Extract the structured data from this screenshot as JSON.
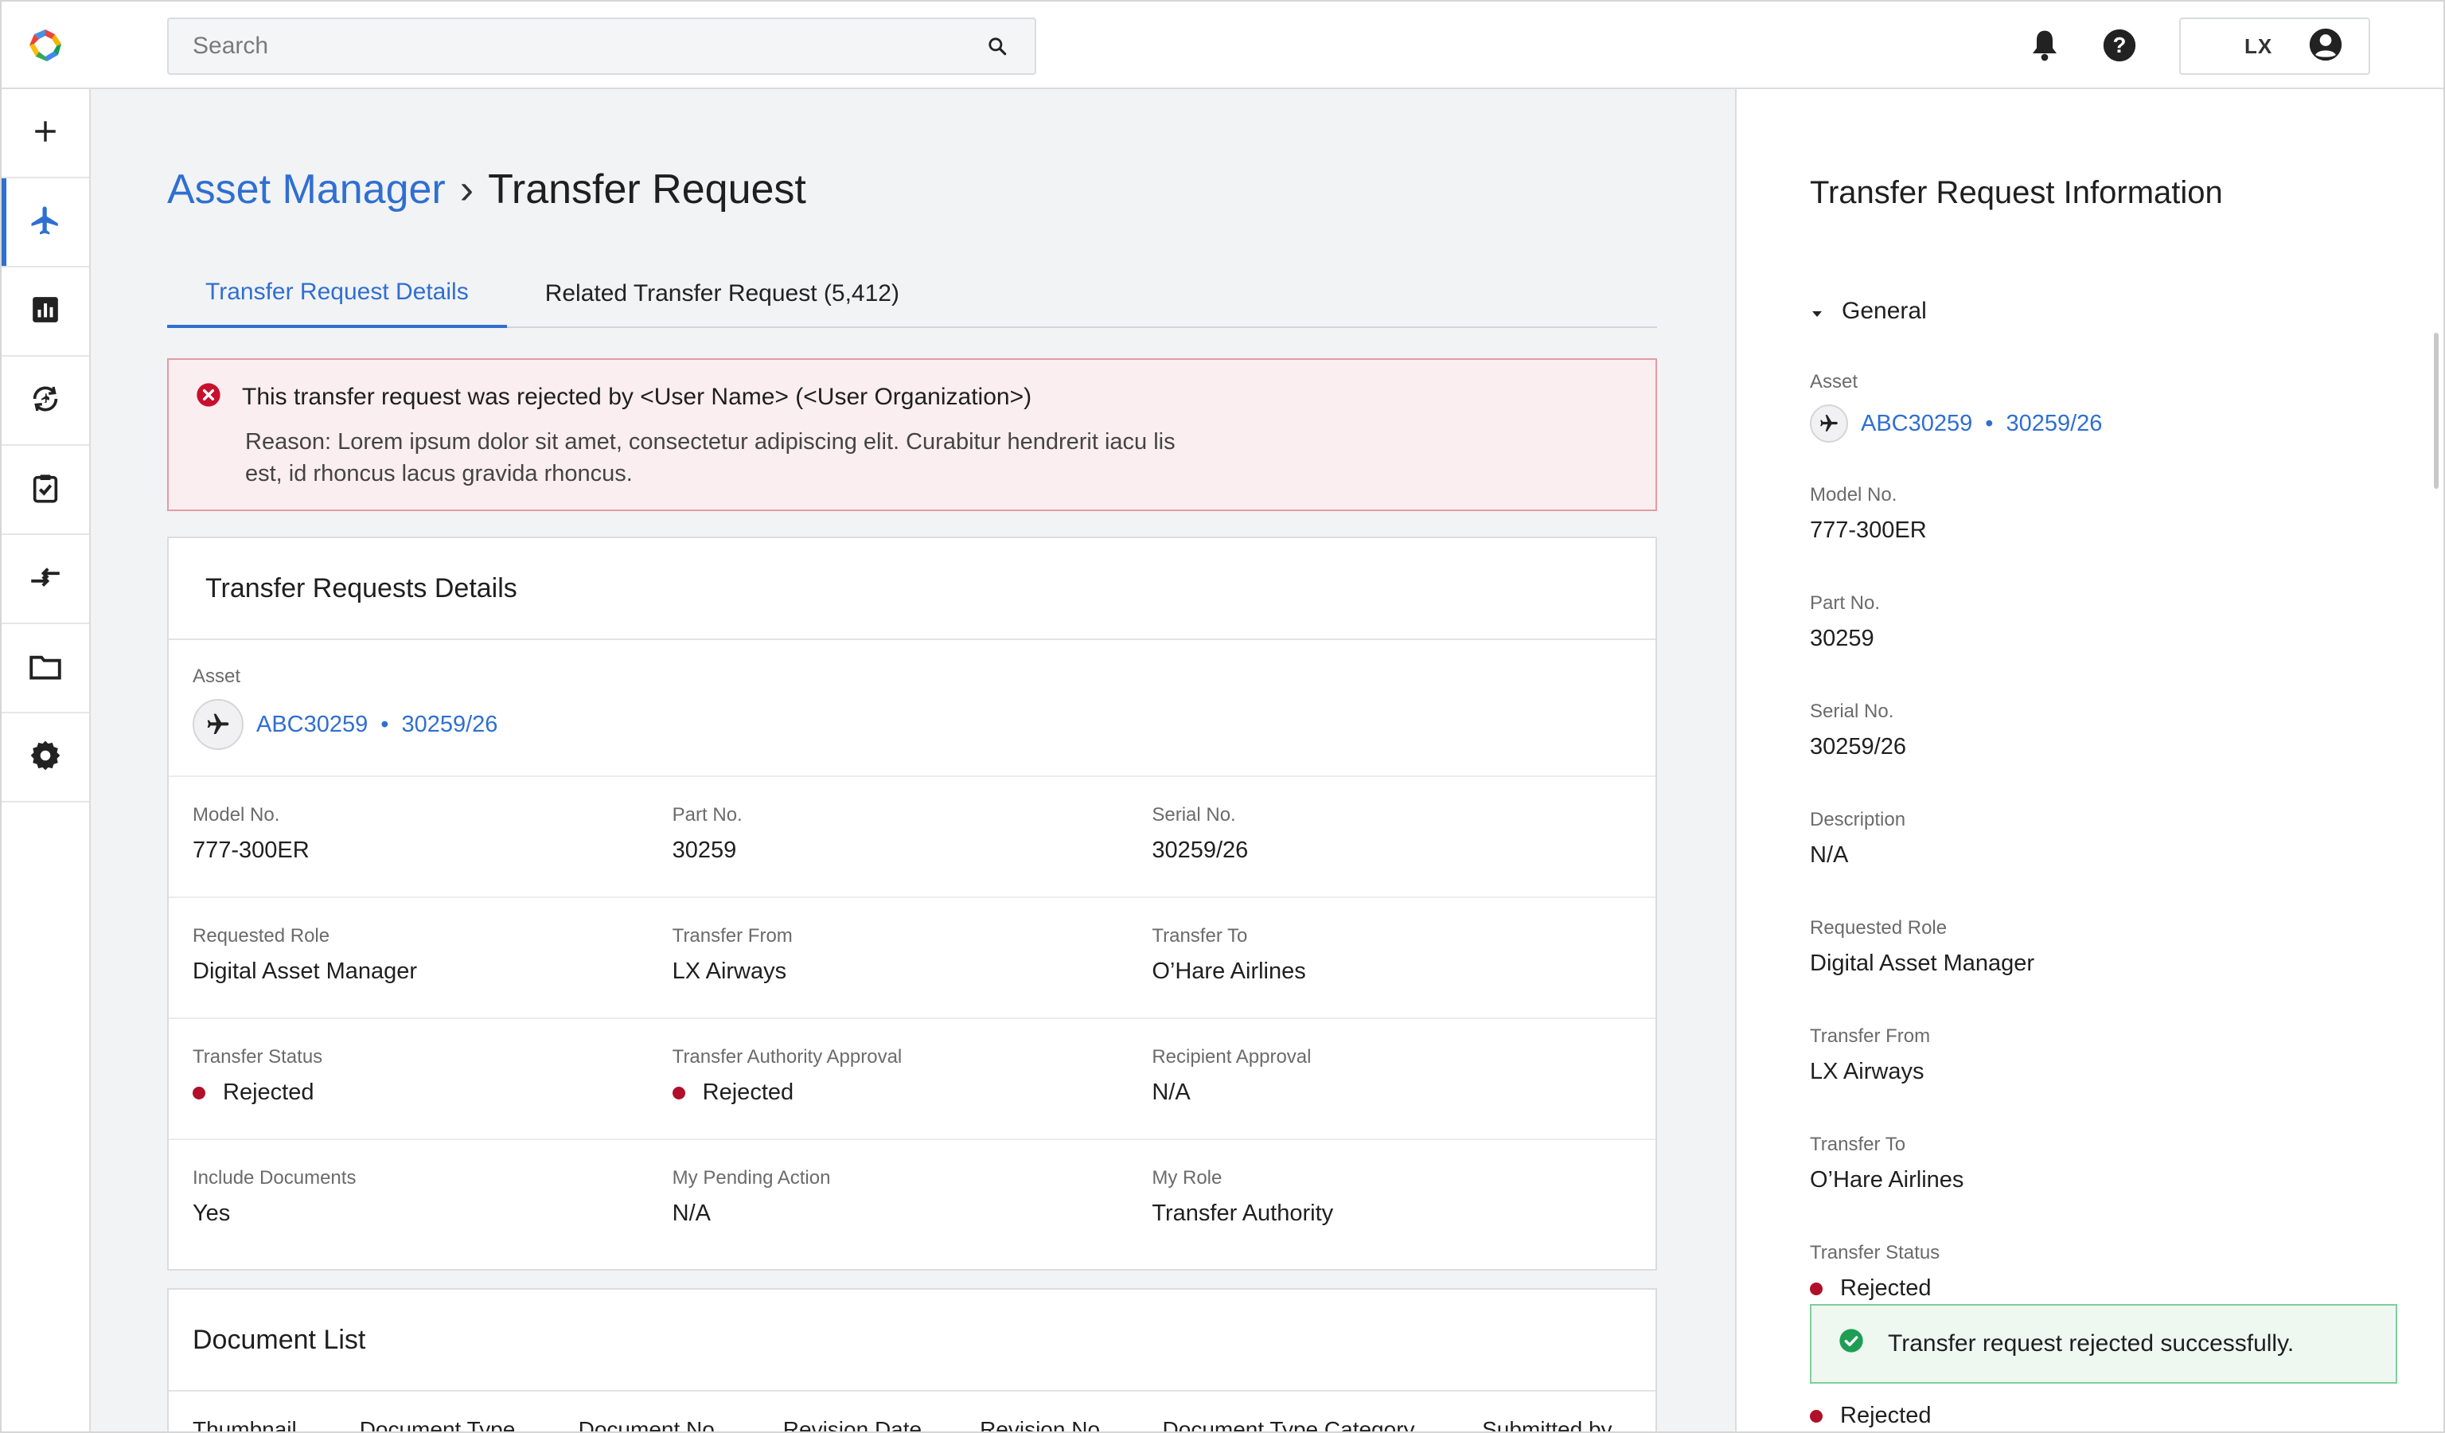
{
  "search": {
    "placeholder": "Search"
  },
  "user": {
    "initials": "LX"
  },
  "nav": {
    "items": [
      {
        "icon": "plus-icon"
      },
      {
        "icon": "airplane-icon",
        "active": true
      },
      {
        "icon": "bar-chart-icon"
      },
      {
        "icon": "sync-icon"
      },
      {
        "icon": "clipboard-check-icon"
      },
      {
        "icon": "transfer-arrows-icon"
      },
      {
        "icon": "folder-icon"
      },
      {
        "icon": "gear-icon"
      }
    ]
  },
  "breadcrumb": {
    "parent": "Asset Manager",
    "separator": "›",
    "current": "Transfer Request"
  },
  "tabs": [
    {
      "label": "Transfer Request Details",
      "active": true
    },
    {
      "label": "Related Transfer Request (5,412)",
      "active": false
    }
  ],
  "alert": {
    "title": "This transfer request was rejected by <User Name> (<User Organization>)",
    "reason": "Reason: Lorem ipsum dolor sit amet, consectetur adipiscing elit. Curabitur hendrerit iacu lis est, id rhoncus lacus gravida rhoncus."
  },
  "details": {
    "header": "Transfer Requests Details",
    "asset": {
      "label": "Asset",
      "id": "ABC30259",
      "bullet": "•",
      "serial": "30259/26"
    },
    "model": {
      "label": "Model No.",
      "value": "777-300ER"
    },
    "part": {
      "label": "Part No.",
      "value": "30259"
    },
    "serial": {
      "label": "Serial No.",
      "value": "30259/26"
    },
    "requested_role": {
      "label": "Requested Role",
      "value": "Digital Asset Manager"
    },
    "transfer_from": {
      "label": "Transfer From",
      "value": "LX Airways"
    },
    "transfer_to": {
      "label": "Transfer To",
      "value": "O’Hare Airlines"
    },
    "transfer_status": {
      "label": "Transfer Status",
      "value": "Rejected"
    },
    "authority_approval": {
      "label": "Transfer Authority Approval",
      "value": "Rejected"
    },
    "recipient_approval": {
      "label": "Recipient Approval",
      "value": "N/A"
    },
    "include_documents": {
      "label": "Include Documents",
      "value": "Yes"
    },
    "pending_action": {
      "label": "My Pending Action",
      "value": "N/A"
    },
    "my_role": {
      "label": "My Role",
      "value": "Transfer Authority"
    }
  },
  "documents": {
    "header": "Document List",
    "columns": [
      "Thumbnail",
      "Document Type",
      "Document No.",
      "Revision Date",
      "Revision No.",
      "Document Type Category",
      "Submitted by"
    ]
  },
  "info_panel": {
    "title": "Transfer Request Information",
    "section": "General",
    "asset_label": "Asset",
    "asset_id": "ABC30259",
    "asset_bullet": "•",
    "asset_serial": "30259/26",
    "model_label": "Model No.",
    "model_value": "777-300ER",
    "part_label": "Part No.",
    "part_value": "30259",
    "serial_label": "Serial No.",
    "serial_value": "30259/26",
    "description_label": "Description",
    "description_value": "N/A",
    "role_label": "Requested Role",
    "role_value": "Digital Asset Manager",
    "from_label": "Transfer From",
    "from_value": "LX Airways",
    "to_label": "Transfer To",
    "to_value": "O’Hare Airlines",
    "status_label": "Transfer Status",
    "status_value": "Rejected",
    "status2_value": "Rejected"
  },
  "toast": {
    "message": "Transfer request rejected successfully."
  },
  "colors": {
    "accent": "#2f6fd1",
    "danger": "#b0102a",
    "success": "#1e9e55"
  }
}
